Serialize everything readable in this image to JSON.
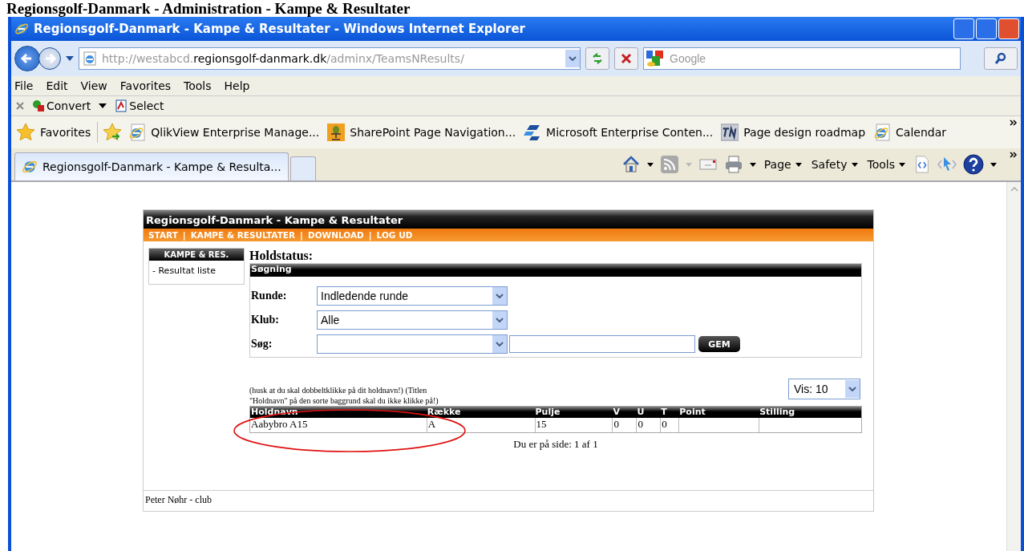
{
  "page_heading": "Regionsgolf-Danmark - Administration - Kampe & Resultater",
  "window": {
    "title": "Regionsgolf-Danmark - Kampe & Resultater - Windows Internet Explorer"
  },
  "address_bar": {
    "url_prefix": "http://westabcd.",
    "url_domain": "regionsgolf-danmark.dk",
    "url_path": "/adminx/TeamsNResults/"
  },
  "search_box": {
    "placeholder": "Google"
  },
  "menu": [
    "File",
    "Edit",
    "View",
    "Favorites",
    "Tools",
    "Help"
  ],
  "pdf_toolbar": {
    "convert": "Convert",
    "select": "Select"
  },
  "favorites_bar": {
    "label": "Favorites",
    "links": [
      {
        "label": "QlikView Enterprise Manage...",
        "kind": "ie"
      },
      {
        "label": "SharePoint Page Navigation...",
        "kind": "robot"
      },
      {
        "label": "Microsoft Enterprise Conten...",
        "kind": "ms"
      },
      {
        "label": "Page design roadmap",
        "kind": "tn"
      },
      {
        "label": "Calendar",
        "kind": "ie"
      }
    ]
  },
  "tabs": [
    {
      "label": "Regionsgolf-Danmark - Kampe & Resulta...",
      "selected": true
    }
  ],
  "command_bar": [
    "Page",
    "Safety",
    "Tools"
  ],
  "site": {
    "title": "Regionsgolf-Danmark - Kampe & Resultater",
    "nav_separator": "|",
    "nav": [
      "START",
      "KAMPE & RESULTATER",
      "DOWNLOAD",
      "LOG UD"
    ]
  },
  "sidebar": {
    "heading": "KAMPE & RES.",
    "items": [
      "- Resultat liste"
    ]
  },
  "heading": "Holdstatus:",
  "search_panel": {
    "title": "Søgning",
    "fields": [
      {
        "label": "Runde:",
        "value": "Indledende runde",
        "kind": "select"
      },
      {
        "label": "Klub:",
        "value": "Alle",
        "kind": "select"
      },
      {
        "label": "Søg:",
        "kind": "select_text"
      }
    ],
    "button": "GEM"
  },
  "hint": "(husk at du skal dobbeltklikke på dit holdnavn!) (Titlen \"Holdnavn\" på den sorte baggrund skal du ikke klikke på!)",
  "page_size": {
    "value": "Vis: 10"
  },
  "table": {
    "columns": [
      "Holdnavn",
      "Række",
      "Pulje",
      "V",
      "U",
      "T",
      "Point",
      "Stilling"
    ],
    "rows": [
      [
        "Aabybro A15",
        "A",
        "15",
        "0",
        "0",
        "0"
      ]
    ]
  },
  "pagination": "Du er på side: 1 af 1",
  "footer": "Peter Nøhr - club"
}
